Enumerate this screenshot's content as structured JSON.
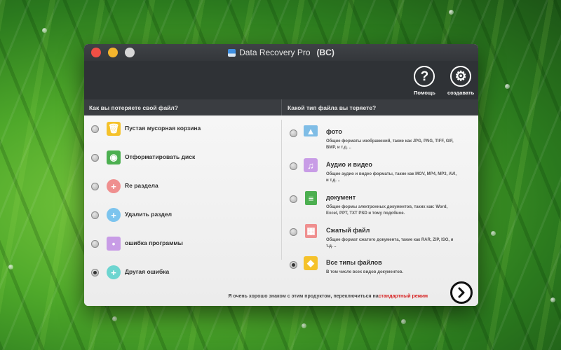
{
  "window": {
    "title": "Data Recovery Pro",
    "edition": "(BC)"
  },
  "toolbar": {
    "help_label": "Помощь",
    "settings_label": "создавать"
  },
  "left_panel": {
    "heading": "Как вы потеряете свой файл?",
    "options": [
      {
        "label": "Пустая мусорная корзина",
        "icon": "trash-icon",
        "color": "#f5c22b"
      },
      {
        "label": "Отформатировать диск",
        "icon": "disk-format-icon",
        "color": "#4caf50"
      },
      {
        "label": "Re раздела",
        "icon": "partition-icon",
        "color": "#ef8f8f"
      },
      {
        "label": "Удалить раздел",
        "icon": "delete-partition-icon",
        "color": "#7cc4ee"
      },
      {
        "label": "ошибка программы",
        "icon": "program-error-icon",
        "color": "#c89ce6"
      },
      {
        "label": "Другая ошибка",
        "icon": "plus-icon",
        "color": "#6dd5d0"
      }
    ],
    "selected_index": 5
  },
  "right_panel": {
    "heading": "Какой тип файла вы теряете?",
    "options": [
      {
        "title": "фото",
        "desc": "Общие форматы изображений, такие как JPG, PNG, TIFF, GIF, BMP, и т.д. ..",
        "icon": "photo-icon",
        "color": "#7fbde6"
      },
      {
        "title": "Аудио и видео",
        "desc": "Общие аудио и видео форматы, такие как MOV, MP4, MP3, AVI, и т.д. ..",
        "icon": "media-icon",
        "color": "#c89ce6"
      },
      {
        "title": "документ",
        "desc": "Общие формы электронных документов, таких как: Word, Excel, PPT, TXT PSD и тому подобное.",
        "icon": "document-icon",
        "color": "#4caf50"
      },
      {
        "title": "Сжатый файл",
        "desc": "Общие формат сжатого документа, такие как RAR, ZIP, ISO, и т.д. ..",
        "icon": "archive-icon",
        "color": "#ef8f8f"
      },
      {
        "title": "Все типы файлов",
        "desc": "В том числе всех видов документов.",
        "icon": "box-icon",
        "color": "#f5c22b"
      }
    ],
    "selected_index": 4
  },
  "footer": {
    "text": "Я очень хорошо знаком с этим продуктом, переключиться на",
    "link": "стандартный режим"
  }
}
